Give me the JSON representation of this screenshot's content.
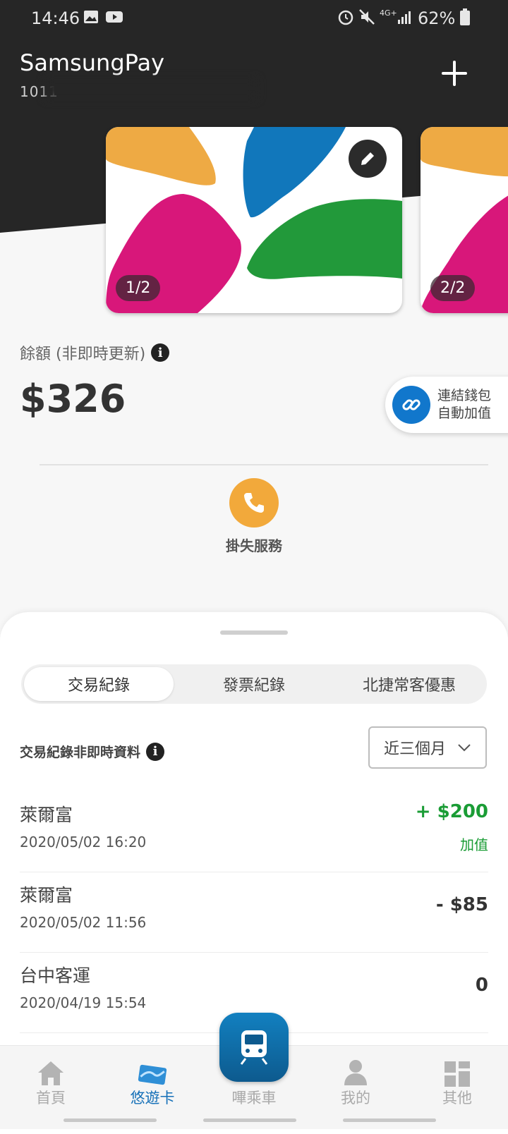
{
  "status_bar": {
    "time": "14:46",
    "network": "4G+",
    "battery": "62%",
    "icons": [
      "image-icon",
      "youtube-icon",
      "alarm-icon",
      "mute-icon",
      "signal-icon",
      "battery-icon"
    ]
  },
  "header": {
    "app_title": "SamsungPay",
    "account_partial": "1011"
  },
  "cards": [
    {
      "badge": "1/2"
    },
    {
      "badge": "2/2"
    }
  ],
  "balance": {
    "label": "餘額 (非即時更新)",
    "amount": "$326"
  },
  "link_wallet": {
    "line1": "連結錢包",
    "line2": "自動加值"
  },
  "lost_service": {
    "label": "掛失服務"
  },
  "tabs": [
    {
      "label": "交易紀錄",
      "active": true
    },
    {
      "label": "發票紀錄",
      "active": false
    },
    {
      "label": "北捷常客優惠",
      "active": false
    }
  ],
  "records": {
    "note": "交易紀錄非即時資料",
    "range": "近三個月"
  },
  "transactions": [
    {
      "merchant": "萊爾富",
      "datetime": "2020/05/02  16:20",
      "amount": "+ $200",
      "tag": "加值"
    },
    {
      "merchant": "萊爾富",
      "datetime": "2020/05/02  11:56",
      "amount": "- $85"
    },
    {
      "merchant": "台中客運",
      "datetime": "2020/04/19  15:54",
      "amount": "0"
    }
  ],
  "bottom_nav": {
    "items": [
      {
        "label": "首頁",
        "icon": "home-icon"
      },
      {
        "label": "悠遊卡",
        "icon": "card-icon",
        "active": true
      },
      {
        "label": "嗶乘車",
        "icon": "train-icon"
      },
      {
        "label": "我的",
        "icon": "person-icon"
      },
      {
        "label": "其他",
        "icon": "grid-icon"
      }
    ]
  },
  "colors": {
    "accent_blue": "#1570b8",
    "positive_green": "#1a9c35",
    "lost_orange": "#f2a93b",
    "header_dark": "#262626"
  }
}
